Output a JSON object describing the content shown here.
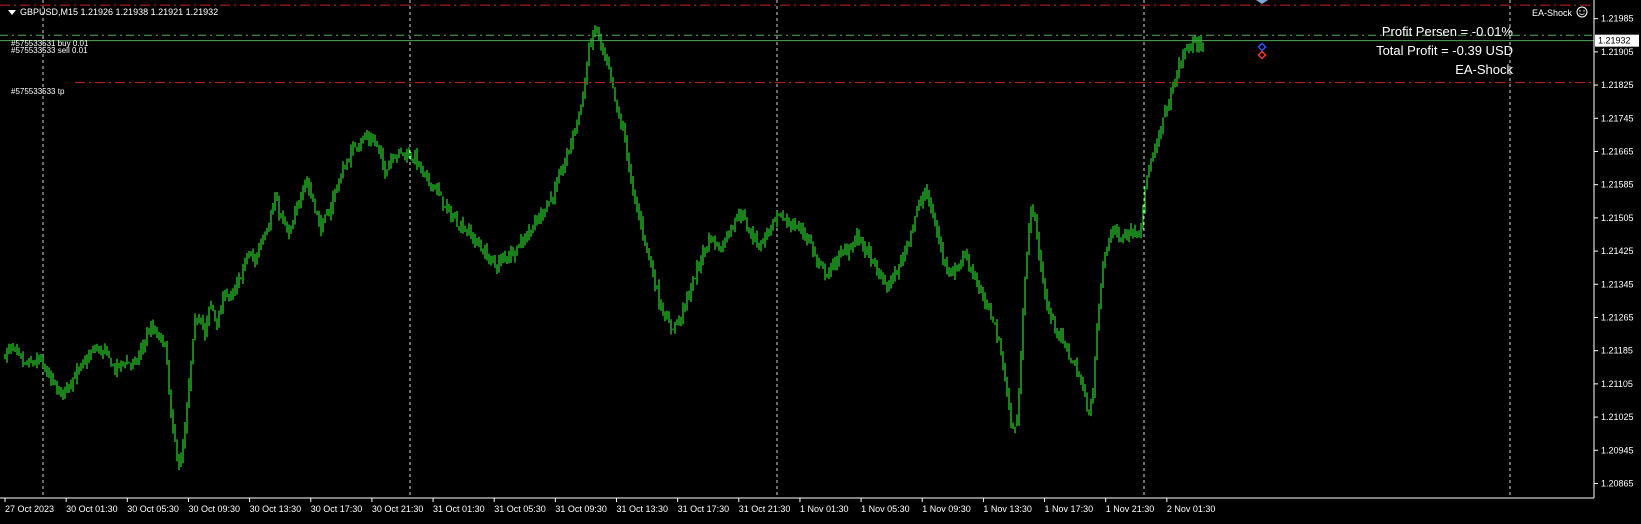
{
  "header": {
    "symbol_line": "GBPUSD,M15  1.21926 1.21938 1.21921 1.21932",
    "menu_icon": "triangle-down-icon",
    "ea_name": "EA-Shock",
    "ea_icon": "smiley-icon"
  },
  "overlay": {
    "profit_persen": "Profit Persen = -0.01%",
    "total_profit": "Total Profit = -0.39 USD",
    "ea_label": "EA-Shock"
  },
  "orders": {
    "buy_label": "#575533531 buy 0.01",
    "sell_label": "#575533533 sell 0.01",
    "tp_label": "#575533533 tp"
  },
  "colors": {
    "background": "#000000",
    "candle": "#33ff33",
    "grid": "#ffffff",
    "tp_line": "#cc2222",
    "order_line": "#55aa55",
    "price_box": "#ffffff"
  },
  "chart_data": {
    "type": "candlestick",
    "ylim": [
      1.2083,
      1.2203
    ],
    "y_ticks": [
      "1.21985",
      "1.21905",
      "1.21825",
      "1.21745",
      "1.21665",
      "1.21585",
      "1.21505",
      "1.21425",
      "1.21345",
      "1.21265",
      "1.21185",
      "1.21105",
      "1.21025",
      "1.20945",
      "1.20865"
    ],
    "current_price": "1.21932",
    "x_ticks": [
      "27 Oct 2023",
      "30 Oct 01:30",
      "30 Oct 05:30",
      "30 Oct 09:30",
      "30 Oct 13:30",
      "30 Oct 17:30",
      "30 Oct 21:30",
      "31 Oct 01:30",
      "31 Oct 05:30",
      "31 Oct 09:30",
      "31 Oct 13:30",
      "31 Oct 17:30",
      "31 Oct 21:30",
      "1 Nov 01:30",
      "1 Nov 05:30",
      "1 Nov 09:30",
      "1 Nov 13:30",
      "1 Nov 17:30",
      "1 Nov 21:30",
      "2 Nov 01:30"
    ],
    "order_levels": {
      "top": 1.2202,
      "buy": 1.21945,
      "sell": 1.21932,
      "tp": 1.21831
    },
    "close_path": [
      [
        0,
        1.2117
      ],
      [
        12,
        1.2119
      ],
      [
        25,
        1.2115
      ],
      [
        40,
        1.2116
      ],
      [
        60,
        1.2108
      ],
      [
        80,
        1.2114
      ],
      [
        95,
        1.2119
      ],
      [
        105,
        1.2118
      ],
      [
        115,
        1.2114
      ],
      [
        125,
        1.2116
      ],
      [
        135,
        1.2115
      ],
      [
        150,
        1.2124
      ],
      [
        165,
        1.212
      ],
      [
        172,
        1.21
      ],
      [
        180,
        1.209
      ],
      [
        186,
        1.2101
      ],
      [
        190,
        1.2113
      ],
      [
        195,
        1.2125
      ],
      [
        200,
        1.2128
      ],
      [
        205,
        1.2122
      ],
      [
        210,
        1.213
      ],
      [
        218,
        1.2125
      ],
      [
        225,
        1.2133
      ],
      [
        232,
        1.2131
      ],
      [
        240,
        1.2136
      ],
      [
        248,
        1.2142
      ],
      [
        255,
        1.214
      ],
      [
        262,
        1.2146
      ],
      [
        270,
        1.215
      ],
      [
        275,
        1.2155
      ],
      [
        282,
        1.215
      ],
      [
        290,
        1.2146
      ],
      [
        297,
        1.2153
      ],
      [
        305,
        1.216
      ],
      [
        313,
        1.2155
      ],
      [
        320,
        1.2148
      ],
      [
        328,
        1.2151
      ],
      [
        335,
        1.2157
      ],
      [
        345,
        1.2163
      ],
      [
        355,
        1.2168
      ],
      [
        365,
        1.217
      ],
      [
        375,
        1.2169
      ],
      [
        385,
        1.2162
      ],
      [
        393,
        1.2166
      ],
      [
        405,
        1.2166
      ],
      [
        415,
        1.2165
      ],
      [
        425,
        1.216
      ],
      [
        435,
        1.2158
      ],
      [
        445,
        1.2153
      ],
      [
        455,
        1.215
      ],
      [
        465,
        1.2148
      ],
      [
        475,
        1.2145
      ],
      [
        485,
        1.2142
      ],
      [
        495,
        1.2139
      ],
      [
        505,
        1.2141
      ],
      [
        515,
        1.2143
      ],
      [
        525,
        1.2146
      ],
      [
        535,
        1.2149
      ],
      [
        545,
        1.2153
      ],
      [
        555,
        1.2157
      ],
      [
        565,
        1.2164
      ],
      [
        575,
        1.2172
      ],
      [
        583,
        1.218
      ],
      [
        590,
        1.2193
      ],
      [
        597,
        1.2196
      ],
      [
        603,
        1.219
      ],
      [
        610,
        1.2185
      ],
      [
        617,
        1.2176
      ],
      [
        625,
        1.217
      ],
      [
        632,
        1.2157
      ],
      [
        640,
        1.215
      ],
      [
        650,
        1.214
      ],
      [
        660,
        1.213
      ],
      [
        670,
        1.2124
      ],
      [
        680,
        1.2126
      ],
      [
        690,
        1.2133
      ],
      [
        700,
        1.214
      ],
      [
        710,
        1.2146
      ],
      [
        720,
        1.2143
      ],
      [
        730,
        1.2148
      ],
      [
        740,
        1.2152
      ],
      [
        750,
        1.2147
      ],
      [
        760,
        1.2144
      ],
      [
        770,
        1.2148
      ],
      [
        780,
        1.2151
      ],
      [
        790,
        1.2149
      ],
      [
        800,
        1.2148
      ],
      [
        810,
        1.2145
      ],
      [
        818,
        1.2139
      ],
      [
        828,
        1.2137
      ],
      [
        838,
        1.2141
      ],
      [
        848,
        1.2143
      ],
      [
        858,
        1.2146
      ],
      [
        868,
        1.2142
      ],
      [
        878,
        1.2137
      ],
      [
        888,
        1.2134
      ],
      [
        898,
        1.2138
      ],
      [
        908,
        1.2145
      ],
      [
        918,
        1.2153
      ],
      [
        926,
        1.2157
      ],
      [
        934,
        1.215
      ],
      [
        944,
        1.214
      ],
      [
        954,
        1.2137
      ],
      [
        964,
        1.2142
      ],
      [
        974,
        1.2137
      ],
      [
        984,
        1.213
      ],
      [
        994,
        1.2126
      ],
      [
        1004,
        1.2114
      ],
      [
        1012,
        1.2099
      ],
      [
        1018,
        1.2102
      ],
      [
        1024,
        1.2134
      ],
      [
        1032,
        1.2155
      ],
      [
        1040,
        1.214
      ],
      [
        1048,
        1.2128
      ],
      [
        1056,
        1.2124
      ],
      [
        1064,
        1.212
      ],
      [
        1072,
        1.2116
      ],
      [
        1080,
        1.2112
      ],
      [
        1088,
        1.2104
      ],
      [
        1093,
        1.2108
      ],
      [
        1098,
        1.2128
      ],
      [
        1105,
        1.2142
      ],
      [
        1112,
        1.2148
      ],
      [
        1120,
        1.2146
      ],
      [
        1130,
        1.2147
      ],
      [
        1140,
        1.2148
      ],
      [
        1148,
        1.2162
      ],
      [
        1156,
        1.2167
      ],
      [
        1164,
        1.2175
      ],
      [
        1172,
        1.2181
      ],
      [
        1180,
        1.2188
      ],
      [
        1188,
        1.2192
      ],
      [
        1196,
        1.2192
      ],
      [
        1204,
        1.2193
      ]
    ]
  }
}
